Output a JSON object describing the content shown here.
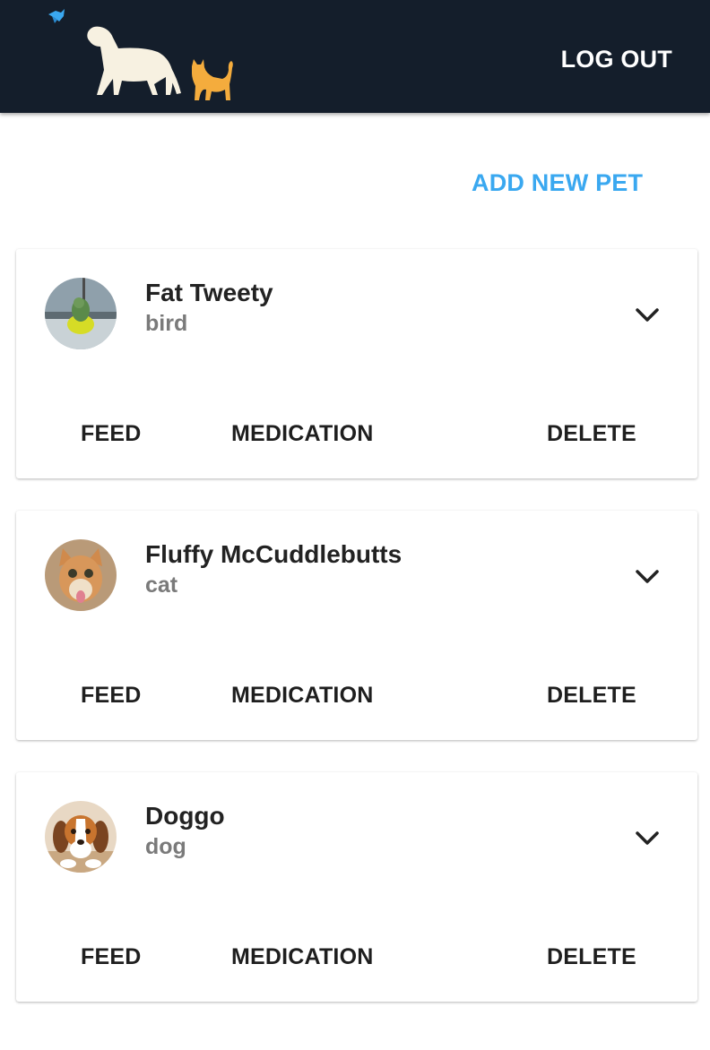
{
  "header": {
    "logo_icons": [
      "bird-icon",
      "dog-icon",
      "cat-icon"
    ],
    "logout_label": "LOG OUT",
    "background": "#141e2b"
  },
  "add_pet_label": "ADD NEW PET",
  "accent_color": "#3aa8f0",
  "pets": [
    {
      "name": "Fat Tweety",
      "species": "bird",
      "avatar_icon": "bird-photo-avatar",
      "actions": {
        "feed": "FEED",
        "medication": "MEDICATION",
        "delete": "DELETE"
      },
      "expand_icon": "chevron-down-icon"
    },
    {
      "name": "Fluffy McCuddlebutts",
      "species": "cat",
      "avatar_icon": "cat-photo-avatar",
      "actions": {
        "feed": "FEED",
        "medication": "MEDICATION",
        "delete": "DELETE"
      },
      "expand_icon": "chevron-down-icon"
    },
    {
      "name": "Doggo",
      "species": "dog",
      "avatar_icon": "dog-photo-avatar",
      "actions": {
        "feed": "FEED",
        "medication": "MEDICATION",
        "delete": "DELETE"
      },
      "expand_icon": "chevron-down-icon"
    }
  ]
}
